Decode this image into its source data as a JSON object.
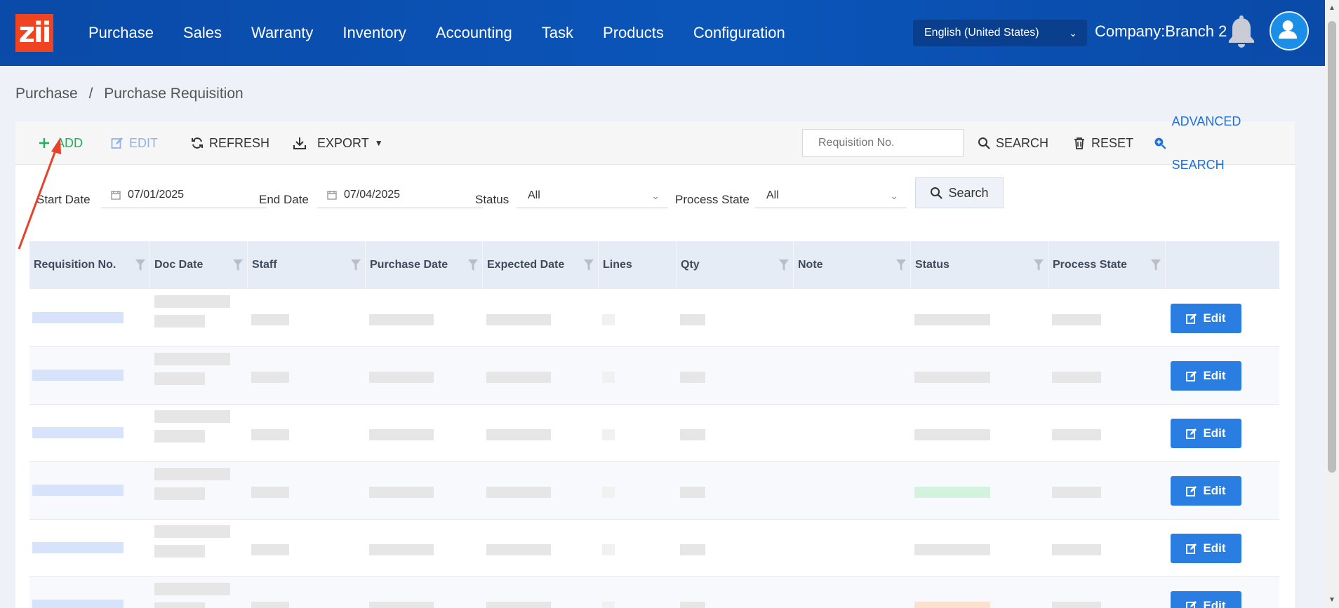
{
  "brand": {
    "logo_text": "zii",
    "logo_color": "#f0431f"
  },
  "nav": {
    "items": [
      "Purchase",
      "Sales",
      "Warranty",
      "Inventory",
      "Accounting",
      "Task",
      "Products",
      "Configuration"
    ]
  },
  "header": {
    "language": "English (United States)",
    "company": "Company:Branch 2"
  },
  "breadcrumb": {
    "root": "Purchase",
    "separator": "/",
    "current": "Purchase Requisition"
  },
  "toolbar": {
    "add_label": "ADD",
    "edit_label": "EDIT",
    "refresh_label": "REFRESH",
    "export_label": "EXPORT",
    "search_placeholder": "Requisition No.",
    "search_label": "SEARCH",
    "reset_label": "RESET",
    "advanced_label": "ADVANCED SEARCH"
  },
  "filters": {
    "start_label": "Start Date",
    "start_value": "07/01/2025",
    "end_label": "End Date",
    "end_value": "07/04/2025",
    "status_label": "Status",
    "status_value": "All",
    "process_label": "Process State",
    "process_value": "All",
    "search_button": "Search"
  },
  "table": {
    "columns": [
      "Requisition No.",
      "Doc Date",
      "Staff",
      "Purchase Date",
      "Expected Date",
      "Lines",
      "Qty",
      "Note",
      "Status",
      "Process State"
    ],
    "row_action": "Edit",
    "row_count": 6
  },
  "colors": {
    "nav_bg": "#0b55b9",
    "add": "#19b35b",
    "accent": "#2a7de1",
    "annotation": "#e8412b"
  }
}
